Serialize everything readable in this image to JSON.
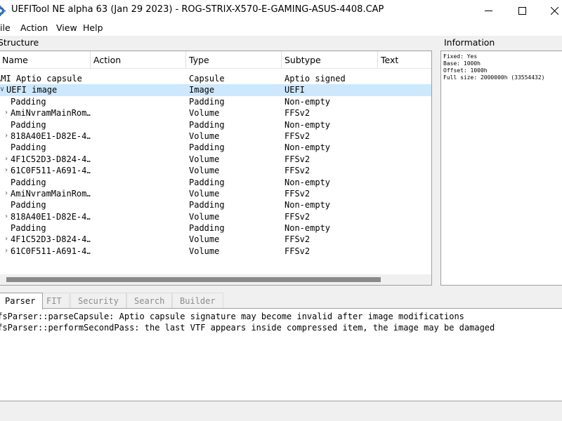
{
  "window": {
    "title": "UEFITool NE alpha 63 (Jan 29 2023) - ROG-STRIX-X570-E-GAMING-ASUS-4408.CAP"
  },
  "menu": [
    "ile",
    "Action",
    "View",
    "Help"
  ],
  "structure": {
    "label": "Structure",
    "columns": [
      "Name",
      "Action",
      "Type",
      "Subtype",
      "Text"
    ],
    "rows": [
      {
        "name": "AMI Aptio capsule",
        "type": "Capsule",
        "subtype": "Aptio signed",
        "expander": ""
      },
      {
        "name": "UEFI image",
        "type": "Image",
        "subtype": "UEFI",
        "expander": "open"
      },
      {
        "name": "Padding",
        "type": "Padding",
        "subtype": "Non-empty",
        "expander": ""
      },
      {
        "name": "AmiNvramMainRom…",
        "type": "Volume",
        "subtype": "FFSv2",
        "expander": "closed"
      },
      {
        "name": "Padding",
        "type": "Padding",
        "subtype": "Non-empty",
        "expander": ""
      },
      {
        "name": "818A40E1-D82E-4…",
        "type": "Volume",
        "subtype": "FFSv2",
        "expander": "closed"
      },
      {
        "name": "Padding",
        "type": "Padding",
        "subtype": "Non-empty",
        "expander": ""
      },
      {
        "name": "4F1C52D3-D824-4…",
        "type": "Volume",
        "subtype": "FFSv2",
        "expander": "closed"
      },
      {
        "name": "61C0F511-A691-4…",
        "type": "Volume",
        "subtype": "FFSv2",
        "expander": "closed"
      },
      {
        "name": "Padding",
        "type": "Padding",
        "subtype": "Non-empty",
        "expander": ""
      },
      {
        "name": "AmiNvramMainRom…",
        "type": "Volume",
        "subtype": "FFSv2",
        "expander": "closed"
      },
      {
        "name": "Padding",
        "type": "Padding",
        "subtype": "Non-empty",
        "expander": ""
      },
      {
        "name": "818A40E1-D82E-4…",
        "type": "Volume",
        "subtype": "FFSv2",
        "expander": "closed"
      },
      {
        "name": "Padding",
        "type": "Padding",
        "subtype": "Non-empty",
        "expander": ""
      },
      {
        "name": "4F1C52D3-D824-4…",
        "type": "Volume",
        "subtype": "FFSv2",
        "expander": "closed"
      },
      {
        "name": "61C0F511-A691-4…",
        "type": "Volume",
        "subtype": "FFSv2",
        "expander": "closed"
      }
    ]
  },
  "information": {
    "label": "Information",
    "lines": [
      "Fixed: Yes",
      "Base: 1000h",
      "Offset: 1000h",
      "Full size: 2000000h (33554432)"
    ]
  },
  "tabs": [
    "Parser",
    "FIT",
    "Security",
    "Search",
    "Builder"
  ],
  "log": [
    "FfsParser::parseCapsule: Aptio capsule signature may become invalid after image modifications",
    "FfsParser::performSecondPass: the last VTF appears inside compressed item, the image may be damaged"
  ],
  "colors": {
    "selection": "#cce8ff",
    "scroll_thumb": "#8a8a8a",
    "border": "#a0a0a0"
  }
}
